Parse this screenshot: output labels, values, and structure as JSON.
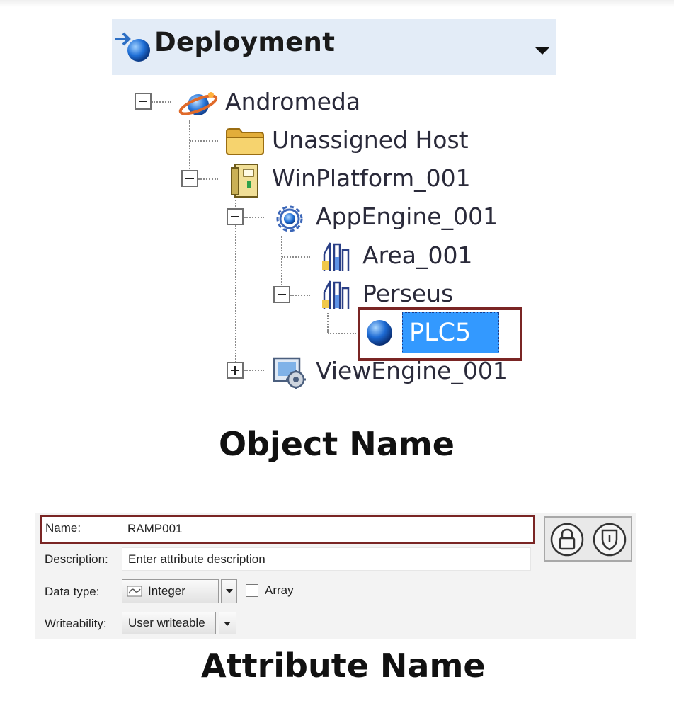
{
  "deployment": {
    "title": "Deployment",
    "tree": {
      "root": "Andromeda",
      "unassigned": "Unassigned Host",
      "platform": "WinPlatform_001",
      "app_engine": "AppEngine_001",
      "area": "Area_001",
      "perseus": "Perseus",
      "selected": "PLC5",
      "view_engine": "ViewEngine_001"
    }
  },
  "captions": {
    "object": "Object Name",
    "attribute": "Attribute Name"
  },
  "attribute_form": {
    "name_label": "Name:",
    "name_value": "RAMP001",
    "description_label": "Description:",
    "description_placeholder": "Enter attribute description",
    "data_type_label": "Data type:",
    "data_type_value": "Integer",
    "array_label": "Array",
    "array_checked": false,
    "writeability_label": "Writeability:",
    "writeability_value": "User writeable"
  },
  "icons": {
    "deployment": "deployment-icon",
    "galaxy": "galaxy-icon",
    "folder": "folder-icon",
    "platform": "platform-icon",
    "engine": "gear-engine-icon",
    "area": "area-icon",
    "instance": "blue-sphere-icon",
    "view_engine": "view-engine-icon",
    "lock": "lock-icon",
    "shield": "shield-icon"
  },
  "colors": {
    "header_bg": "#e3ecf7",
    "selection": "#3399ff",
    "highlight_border": "#7a2524"
  }
}
